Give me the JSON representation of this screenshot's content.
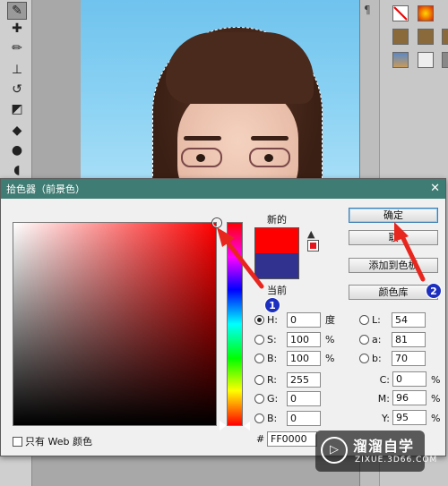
{
  "toolbar": {
    "tools": [
      "eyedropper-icon",
      "healing-brush-icon",
      "brush-icon",
      "stamp-icon",
      "history-brush-icon",
      "eraser-icon",
      "paint-bucket-icon",
      "blur-icon",
      "dodge-icon"
    ]
  },
  "dialog": {
    "title": "拾色器（前景色）",
    "close_glyph": "✕",
    "new_label": "新的",
    "current_label": "当前",
    "new_color": "#ff0000",
    "current_color": "#31318f",
    "buttons": {
      "ok": "确定",
      "cancel": "取",
      "add_to_swatches": "添加到色板",
      "color_libraries": "颜色库"
    },
    "hsb": {
      "h_label": "H:",
      "h_value": "0",
      "h_unit": "度",
      "s_label": "S:",
      "s_value": "100",
      "s_unit": "%",
      "b_label": "B:",
      "b_value": "100",
      "b_unit": "%"
    },
    "rgb": {
      "r_label": "R:",
      "r_value": "255",
      "g_label": "G:",
      "g_value": "0",
      "b_label": "B:",
      "b_value": "0"
    },
    "lab": {
      "l_label": "L:",
      "l_value": "54",
      "a_label": "a:",
      "a_value": "81",
      "b_label": "b:",
      "b_value": "70"
    },
    "cmyk": {
      "c_label": "C:",
      "c_value": "0",
      "c_unit": "%",
      "m_label": "M:",
      "m_value": "96",
      "m_unit": "%",
      "y_label": "Y:",
      "y_value": "95",
      "y_unit": "%"
    },
    "hex_label": "#",
    "hex_value": "FF0000",
    "web_only_label": "只有 Web 颜色"
  },
  "annotations": {
    "badge_1": "1",
    "badge_2": "2",
    "arrow_color": "#e8261e"
  },
  "watermark": {
    "logo_glyph": "▷",
    "main": "溜溜自学",
    "sub": "ZIXUE.3D66.COM"
  }
}
